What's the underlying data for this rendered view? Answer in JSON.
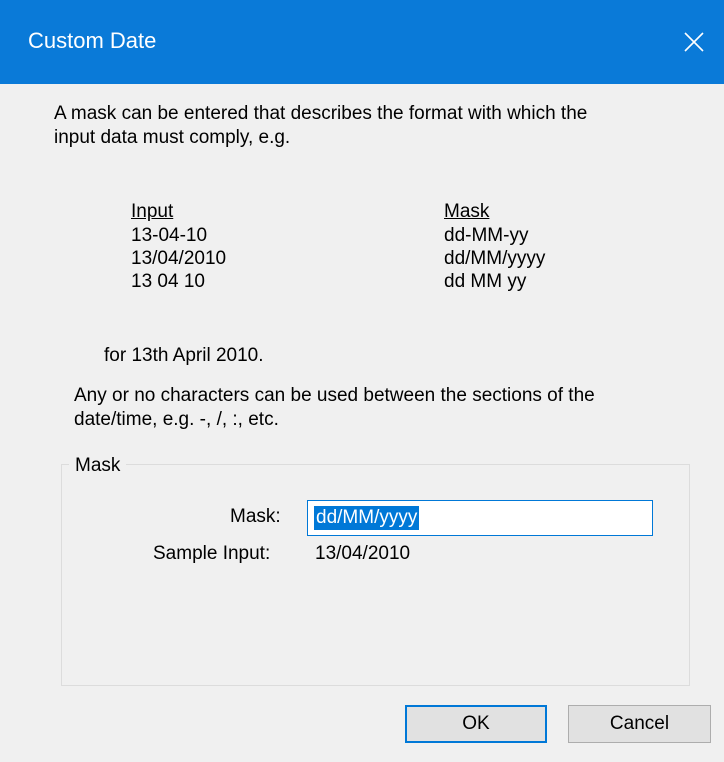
{
  "window": {
    "title": "Custom Date"
  },
  "description": {
    "line1": "A mask can be entered that describes the format with which the",
    "line2": "input data must comply, e.g."
  },
  "examples": {
    "input_header": "Input",
    "mask_header": "Mask",
    "rows": [
      {
        "input": "13-04-10",
        "mask": "dd-MM-yy"
      },
      {
        "input": "13/04/2010",
        "mask": "dd/MM/yyyy"
      },
      {
        "input": "13 04 10",
        "mask": "dd MM yy"
      }
    ]
  },
  "note": "for 13th April 2010.",
  "separator_note": {
    "line1": "Any or no characters can be used between the sections of the",
    "line2": "date/time, e.g. -, /, :, etc."
  },
  "mask_group": {
    "legend": "Mask",
    "mask_label": "Mask:",
    "mask_value": "dd/MM/yyyy",
    "sample_label": "Sample Input:",
    "sample_value": "13/04/2010"
  },
  "buttons": {
    "ok": "OK",
    "cancel": "Cancel"
  },
  "colors": {
    "titlebar": "#0a7ad8",
    "selection": "#0078d7",
    "dialog_bg": "#f0f0f0"
  }
}
